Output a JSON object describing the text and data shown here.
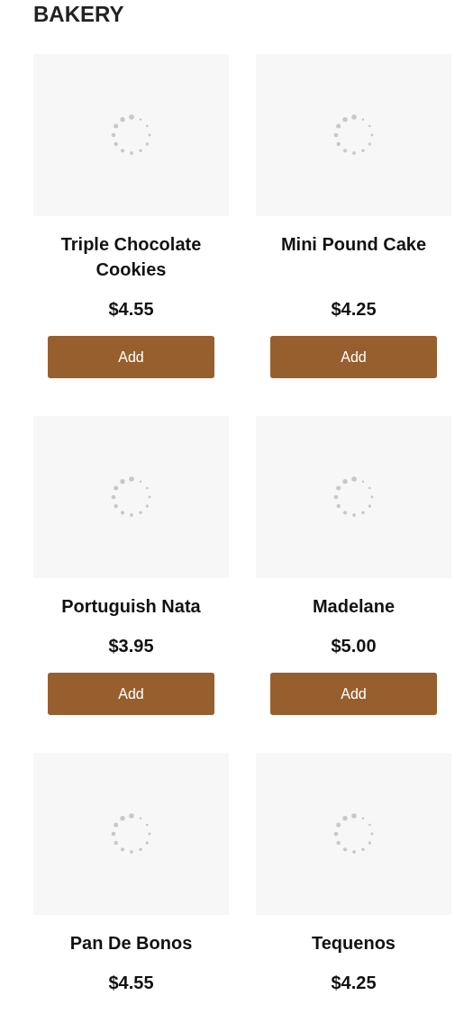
{
  "section_title": "BAKERY",
  "products": [
    {
      "name": "Triple Chocolate Cookies",
      "price": "$4.55",
      "button": "Add"
    },
    {
      "name": "Mini Pound Cake",
      "price": "$4.25",
      "button": "Add"
    },
    {
      "name": "Portuguish Nata",
      "price": "$3.95",
      "button": "Add"
    },
    {
      "name": "Madelane",
      "price": "$5.00",
      "button": "Add"
    },
    {
      "name": "Pan De Bonos",
      "price": "$4.55"
    },
    {
      "name": "Tequenos",
      "price": "$4.25"
    }
  ]
}
